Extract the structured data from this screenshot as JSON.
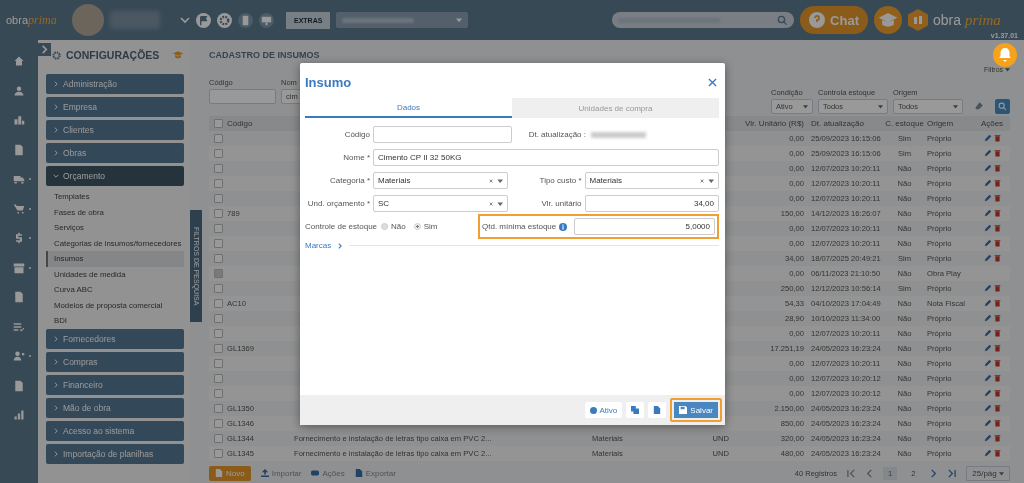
{
  "topbar": {
    "logo": [
      "obra",
      "prima"
    ],
    "extras_button": "EXTRAS",
    "chat_button": "Chat",
    "brand": [
      "obra",
      "prima"
    ],
    "version": "v1.37.01"
  },
  "rail": [
    {
      "kind": "home",
      "dot": false
    },
    {
      "kind": "user",
      "dot": false
    },
    {
      "kind": "buildings",
      "dot": false
    },
    {
      "kind": "document",
      "dot": false
    },
    {
      "kind": "truck",
      "dot": true
    },
    {
      "kind": "cart",
      "dot": true
    },
    {
      "kind": "dollar",
      "dot": true
    },
    {
      "kind": "archive",
      "dot": true
    },
    {
      "kind": "document",
      "dot": false
    },
    {
      "kind": "list-check",
      "dot": false
    },
    {
      "kind": "users",
      "dot": true
    },
    {
      "kind": "document",
      "dot": false
    },
    {
      "kind": "chart",
      "dot": false
    }
  ],
  "sidebar": {
    "title": "CONFIGURAÇÕES",
    "groups": [
      {
        "label": "Administração",
        "expanded": false
      },
      {
        "label": "Empresa",
        "expanded": false
      },
      {
        "label": "Clientes",
        "expanded": false
      },
      {
        "label": "Obras",
        "expanded": false
      },
      {
        "label": "Orçamento",
        "expanded": true,
        "children": [
          {
            "label": "Templates",
            "selected": false
          },
          {
            "label": "Fases de obra",
            "selected": false
          },
          {
            "label": "Serviços",
            "selected": false
          },
          {
            "label": "Categorias de insumos/fornecedores",
            "selected": false
          },
          {
            "label": "Insumos",
            "selected": true
          },
          {
            "label": "Unidades de medida",
            "selected": false
          },
          {
            "label": "Curva ABC",
            "selected": false
          },
          {
            "label": "Modelos de proposta comercial",
            "selected": false
          },
          {
            "label": "BDI",
            "selected": false
          }
        ]
      },
      {
        "label": "Fornecedores",
        "expanded": false
      },
      {
        "label": "Compras",
        "expanded": false
      },
      {
        "label": "Financeiro",
        "expanded": false
      },
      {
        "label": "Mão de obra",
        "expanded": false
      },
      {
        "label": "Acesso ao sistema",
        "expanded": false
      },
      {
        "label": "Importação de planilhas",
        "expanded": false
      }
    ]
  },
  "filter_tab": "FILTROS DE PESQUISA",
  "page": {
    "title": "CADASTRO DE INSUMOS",
    "filters_toggle": "Filtros",
    "filters_left": [
      {
        "label": "Código"
      },
      {
        "label": "Nom",
        "value": "cim"
      }
    ],
    "filters_right": [
      {
        "label": "Condição",
        "value": "Ativo"
      },
      {
        "label": "Controla estoque",
        "value": "Todos"
      },
      {
        "label": "Origem",
        "value": "Todos"
      }
    ]
  },
  "table": {
    "select_all": false,
    "columns": {
      "code": "Código",
      "value": "Vlr. Unitário (R$)",
      "date": "Dt. atualização",
      "stock": "C. estoque",
      "origin": "Origem",
      "actions": "Ações"
    },
    "rows": [
      {
        "code": "",
        "value": "0,00",
        "date": "25/09/2023 16:15:06",
        "stock": "Sim",
        "origin": "Próprio",
        "disabled": false
      },
      {
        "code": "",
        "value": "0,00",
        "date": "25/09/2023 16:15:06",
        "stock": "Sim",
        "origin": "Próprio",
        "disabled": false
      },
      {
        "code": "",
        "value": "0,00",
        "date": "12/07/2023 10:20:11",
        "stock": "Não",
        "origin": "Próprio",
        "disabled": false
      },
      {
        "code": "",
        "value": "0,00",
        "date": "12/07/2023 10:20:11",
        "stock": "Não",
        "origin": "Próprio",
        "disabled": false
      },
      {
        "code": "",
        "value": "0,00",
        "date": "12/07/2023 10:20:11",
        "stock": "Não",
        "origin": "Próprio",
        "disabled": false
      },
      {
        "code": "789",
        "value": "150,00",
        "date": "14/12/2023 16:26:07",
        "stock": "Não",
        "origin": "Próprio",
        "disabled": false
      },
      {
        "code": "",
        "value": "0,00",
        "date": "12/07/2023 10:20:11",
        "stock": "Não",
        "origin": "Próprio",
        "disabled": false
      },
      {
        "code": "",
        "value": "0,00",
        "date": "12/07/2023 10:20:11",
        "stock": "Não",
        "origin": "Próprio",
        "disabled": false
      },
      {
        "code": "",
        "value": "34,00",
        "date": "18/07/2025 20:49:21",
        "stock": "Sim",
        "origin": "Próprio",
        "disabled": false
      },
      {
        "code": "",
        "value": "0,00",
        "date": "06/11/2023 21:10:50",
        "stock": "Não",
        "origin": "Obra Play",
        "disabled": true
      },
      {
        "code": "",
        "value": "250,00",
        "date": "12/12/2023 10:56:14",
        "stock": "Sim",
        "origin": "Próprio",
        "disabled": false
      },
      {
        "code": "AC10",
        "value": "54,33",
        "date": "04/10/2023 17:04:49",
        "stock": "Não",
        "origin": "Nota Fiscal",
        "disabled": false
      },
      {
        "code": "",
        "value": "28,90",
        "date": "10/10/2023 11:34:00",
        "stock": "Não",
        "origin": "Próprio",
        "disabled": false
      },
      {
        "code": "",
        "value": "0,00",
        "date": "12/07/2023 10:20:11",
        "stock": "Não",
        "origin": "Próprio",
        "disabled": false
      },
      {
        "code": "GL1369",
        "value": "17.251,19",
        "date": "24/05/2023 16:23:24",
        "stock": "Não",
        "origin": "Próprio",
        "disabled": false
      },
      {
        "code": "",
        "value": "0,00",
        "date": "12/07/2023 10:20:11",
        "stock": "Não",
        "origin": "Próprio",
        "disabled": false
      },
      {
        "code": "",
        "value": "0,00",
        "date": "12/07/2023 10:20:12",
        "stock": "Não",
        "origin": "Próprio",
        "disabled": false
      },
      {
        "code": "",
        "value": "0,00",
        "date": "12/07/2023 10:20:12",
        "stock": "Não",
        "origin": "Próprio",
        "disabled": false
      },
      {
        "code": "GL1350",
        "value": "2.150,00",
        "date": "24/05/2023 16:23:24",
        "stock": "Não",
        "origin": "Próprio",
        "disabled": false
      },
      {
        "code": "GL1346",
        "value": "850,00",
        "date": "24/05/2023 16:23:24",
        "stock": "Não",
        "origin": "Próprio",
        "disabled": false
      },
      {
        "code": "GL1344",
        "name": "Fornecimento e instalação de letras tipo caixa em PVC 2...",
        "column_4": "Materiais",
        "column_5": "UND",
        "value": "320,00",
        "date": "24/05/2023 16:23:24",
        "stock": "Não",
        "origin": "Próprio",
        "disabled": false
      },
      {
        "code": "GL1345",
        "name": "Fornecimento e instalação de letras tipo caixa em PVC 2...",
        "column_4": "Materiais",
        "column_5": "UND",
        "value": "480,00",
        "date": "24/05/2023 16:23:24",
        "stock": "Não",
        "origin": "Próprio",
        "disabled": false
      }
    ]
  },
  "toolbar": {
    "buttons": [
      "Novo",
      "Importar",
      "Ações",
      "Exportar"
    ],
    "count": "40 Registros",
    "pages": [
      {
        "label": "1",
        "selected": true
      },
      {
        "label": "2",
        "selected": false
      }
    ],
    "page_size": "25/pág"
  },
  "modal": {
    "title": "Insumo",
    "tabs": [
      {
        "label": "Dados",
        "selected": true
      },
      {
        "label": "Unidades de compra",
        "selected": false
      }
    ],
    "code_label": "Código",
    "updated_label": "Dt. atualização :",
    "name_label": "Nome *",
    "name_value": "Cimento CP II 32 50KG",
    "category_label": "Categoria *",
    "category_value": "Materiais",
    "cost_type_label": "Tipo custo *",
    "cost_type_value": "Materiais",
    "unit_label": "Und. orçamento *",
    "unit_value": "SC",
    "price_label": "Vlr. unitário",
    "price_value": "34,00",
    "stock_label": "Controle de estoque",
    "stock_options": [
      {
        "label": "Não",
        "selected": false
      },
      {
        "label": "Sim",
        "selected": true
      }
    ],
    "min_stock_label": "Qtd. mínima estoque",
    "min_stock_value": "5,0000",
    "min_stock_highlighted": true,
    "brands_label": "Marcas",
    "active_label": "Ativo",
    "active": true,
    "save_button": "Salvar",
    "save_highlighted": true
  }
}
